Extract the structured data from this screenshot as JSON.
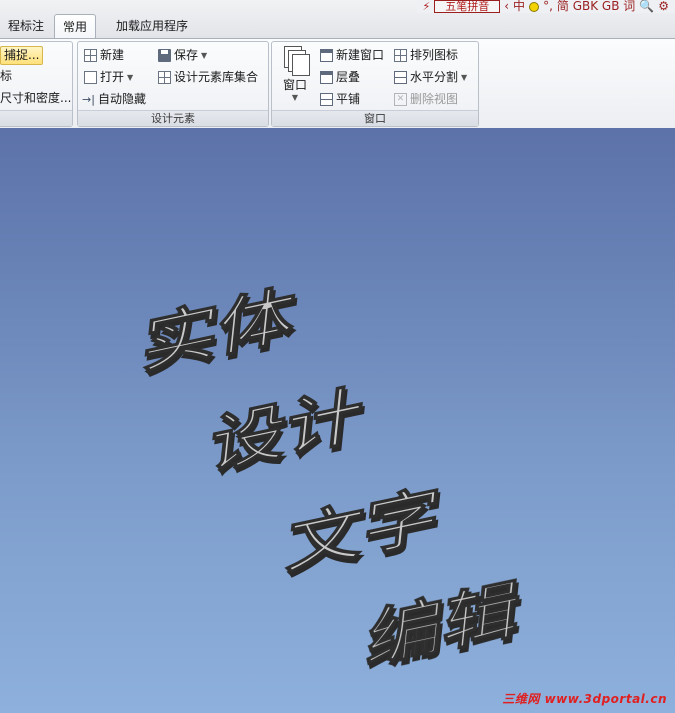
{
  "tabs": [
    {
      "label": "程标注",
      "active": false
    },
    {
      "label": "常用",
      "active": true
    },
    {
      "label": "加载应用程序",
      "active": false
    }
  ],
  "ime": {
    "mode": "五笔拼音",
    "lang": "中",
    "extra": "简 GBK GB 词"
  },
  "ribbon": {
    "partial": {
      "snap": "捕捉...",
      "item2": "标",
      "item3": "尺寸和密度..."
    },
    "design_elements": {
      "label": "设计元素",
      "new": "新建",
      "save": "保存",
      "open": "打开",
      "catalog": "设计元素库集合",
      "autohide": "自动隐藏"
    },
    "window": {
      "label": "窗口",
      "window_btn": "窗口",
      "new_window": "新建窗口",
      "arrange": "排列图标",
      "cascade": "层叠",
      "hsplit": "水平分割",
      "tile": "平铺",
      "delete_view": "删除视图"
    }
  },
  "scene": {
    "lines": [
      "实体",
      "设计",
      "文字",
      "编辑"
    ]
  },
  "watermark": {
    "cn": "三维网",
    "url": "www.3dportal.cn"
  },
  "colors": {
    "viewport_top": "#5c72a9",
    "viewport_bottom": "#8eb0dc",
    "solid_text_face": "#c9c9c9",
    "watermark": "#e02020"
  }
}
